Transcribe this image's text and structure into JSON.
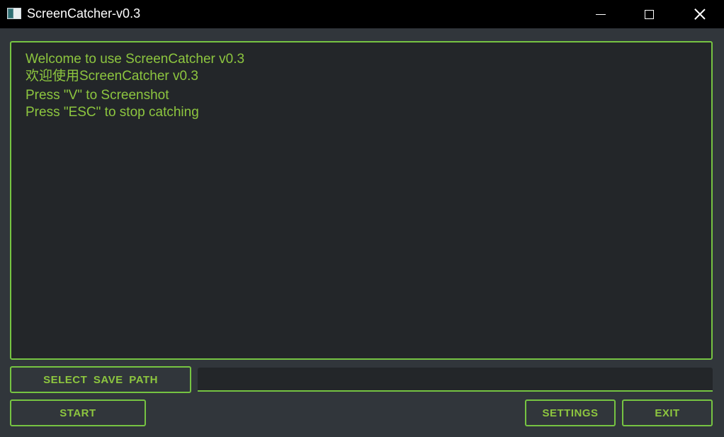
{
  "window": {
    "title": "ScreenCatcher-v0.3",
    "icon": "app-window-icon",
    "controls": {
      "minimize_icon": "minimize-icon",
      "maximize_icon": "maximize-icon",
      "close_icon": "close-icon"
    }
  },
  "log": {
    "lines": [
      "Welcome to use ScreenCatcher v0.3",
      "欢迎使用ScreenCatcher v0.3",
      "Press \"V\" to Screenshot",
      "Press \"ESC\" to stop catching"
    ]
  },
  "controls": {
    "select_save_path_label": "SELECT SAVE PATH",
    "save_path_value": "",
    "start_label": "START",
    "settings_label": "SETTINGS",
    "exit_label": "EXIT"
  },
  "colors": {
    "accent": "#76c442",
    "text_green": "#8dc63f",
    "background": "#31363b",
    "panel": "#232629",
    "titlebar": "#000000"
  }
}
